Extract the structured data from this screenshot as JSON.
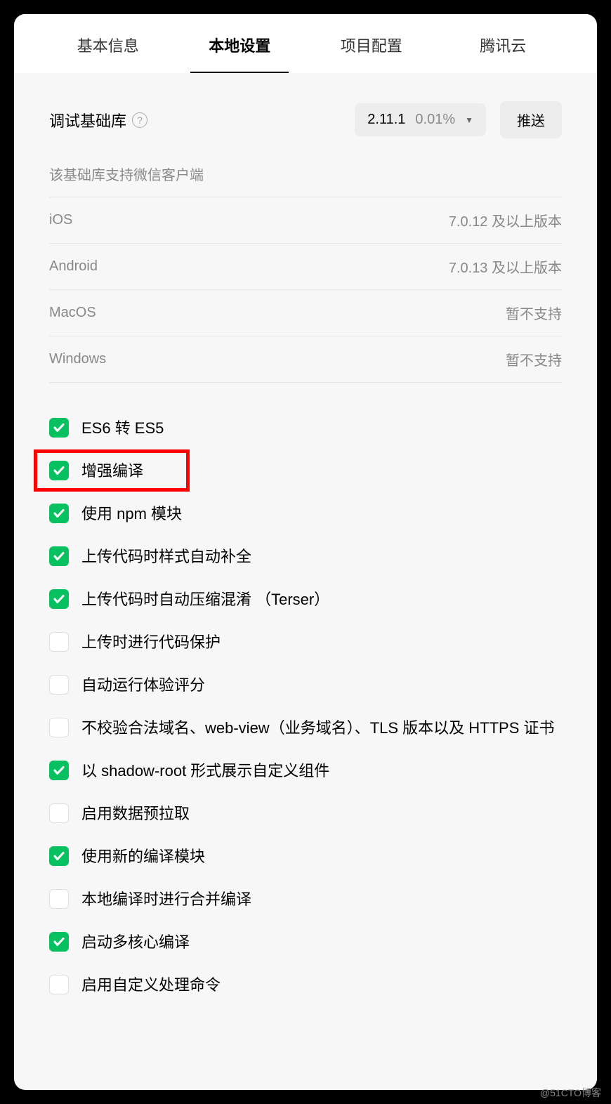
{
  "tabs": [
    {
      "label": "基本信息",
      "active": false
    },
    {
      "label": "本地设置",
      "active": true
    },
    {
      "label": "项目配置",
      "active": false
    },
    {
      "label": "腾讯云",
      "active": false
    }
  ],
  "debugLib": {
    "label": "调试基础库",
    "helpGlyph": "?",
    "version": "2.11.1",
    "percentage": "0.01%",
    "pushLabel": "推送"
  },
  "supportHeader": "该基础库支持微信客户端",
  "supportRows": [
    {
      "platform": "iOS",
      "version": "7.0.12 及以上版本"
    },
    {
      "platform": "Android",
      "version": "7.0.13 及以上版本"
    },
    {
      "platform": "MacOS",
      "version": "暂不支持"
    },
    {
      "platform": "Windows",
      "version": "暂不支持"
    }
  ],
  "options": [
    {
      "label": "ES6 转 ES5",
      "checked": true,
      "highlight": false
    },
    {
      "label": "增强编译",
      "checked": true,
      "highlight": true
    },
    {
      "label": "使用 npm 模块",
      "checked": true,
      "highlight": false
    },
    {
      "label": "上传代码时样式自动补全",
      "checked": true,
      "highlight": false
    },
    {
      "label": "上传代码时自动压缩混淆 （Terser）",
      "checked": true,
      "highlight": false
    },
    {
      "label": "上传时进行代码保护",
      "checked": false,
      "highlight": false
    },
    {
      "label": "自动运行体验评分",
      "checked": false,
      "highlight": false
    },
    {
      "label": "不校验合法域名、web-view（业务域名）、TLS 版本以及 HTTPS 证书",
      "checked": false,
      "highlight": false
    },
    {
      "label": "以 shadow-root 形式展示自定义组件",
      "checked": true,
      "highlight": false
    },
    {
      "label": "启用数据预拉取",
      "checked": false,
      "highlight": false
    },
    {
      "label": "使用新的编译模块",
      "checked": true,
      "highlight": false
    },
    {
      "label": "本地编译时进行合并编译",
      "checked": false,
      "highlight": false
    },
    {
      "label": "启动多核心编译",
      "checked": true,
      "highlight": false
    },
    {
      "label": "启用自定义处理命令",
      "checked": false,
      "highlight": false
    }
  ],
  "watermark": "@51CTO博客"
}
